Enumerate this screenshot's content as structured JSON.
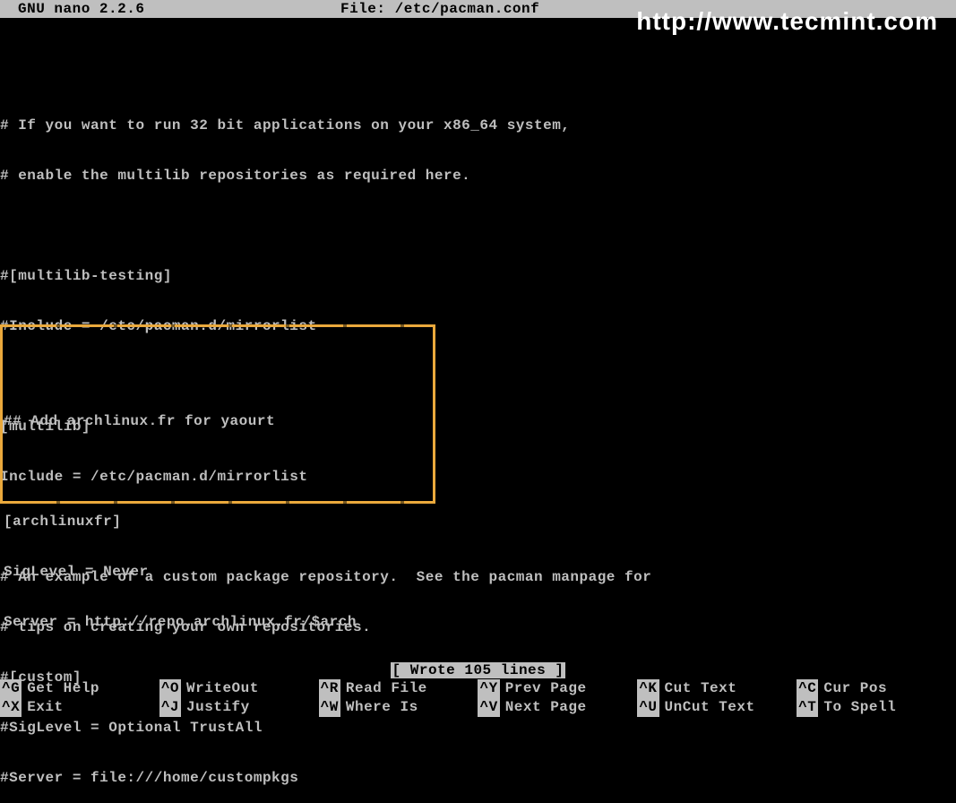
{
  "titlebar": {
    "app": "GNU nano 2.2.6",
    "file_label": "File: /etc/pacman.conf"
  },
  "watermark": "http://www.tecmint.com",
  "lines": [
    "",
    "# If you want to run 32 bit applications on your x86_64 system,",
    "# enable the multilib repositories as required here.",
    "",
    "#[multilib-testing]",
    "#Include = /etc/pacman.d/mirrorlist",
    "",
    "[multilib]",
    "Include = /etc/pacman.d/mirrorlist",
    "",
    "# An example of a custom package repository.  See the pacman manpage for",
    "# tips on creating your own repositories.",
    "#[custom]",
    "#SigLevel = Optional TrustAll",
    "#Server = file:///home/custompkgs"
  ],
  "boxed_lines": [
    "",
    "## Add archlinux.fr for yaourt",
    "",
    "[archlinuxfr]",
    "SigLevel = Never",
    "Server = http://repo.archlinux.fr/$arch"
  ],
  "status": "[ Wrote 105 lines ]",
  "shortcuts": [
    {
      "key": "^G",
      "label": "Get Help"
    },
    {
      "key": "^O",
      "label": "WriteOut"
    },
    {
      "key": "^R",
      "label": "Read File"
    },
    {
      "key": "^Y",
      "label": "Prev Page"
    },
    {
      "key": "^K",
      "label": "Cut Text"
    },
    {
      "key": "^C",
      "label": "Cur Pos"
    },
    {
      "key": "^X",
      "label": "Exit"
    },
    {
      "key": "^J",
      "label": "Justify"
    },
    {
      "key": "^W",
      "label": "Where Is"
    },
    {
      "key": "^V",
      "label": "Next Page"
    },
    {
      "key": "^U",
      "label": "UnCut Text"
    },
    {
      "key": "^T",
      "label": "To Spell"
    }
  ]
}
